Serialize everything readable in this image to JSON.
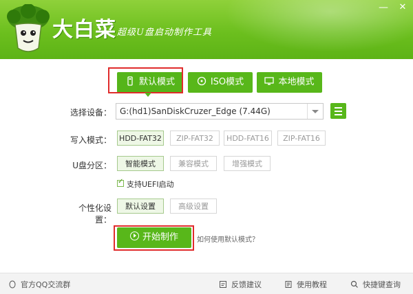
{
  "app": {
    "brand": "大白菜",
    "slogan": "超级U盘启动制作工具"
  },
  "window": {
    "minimize": "—",
    "close": "✕"
  },
  "tabs": [
    {
      "label": "默认模式",
      "icon": "usb-icon",
      "selected": true
    },
    {
      "label": "ISO模式",
      "icon": "disc-icon",
      "selected": false
    },
    {
      "label": "本地模式",
      "icon": "monitor-icon",
      "selected": false
    }
  ],
  "device": {
    "label": "选择设备：",
    "value": "G:(hd1)SanDiskCruzer_Edge (7.44G)",
    "menu_icon": "hamburger-menu-icon"
  },
  "write_mode": {
    "label": "写入模式：",
    "options": [
      "HDD-FAT32",
      "ZIP-FAT32",
      "HDD-FAT16",
      "ZIP-FAT16"
    ],
    "selected": "HDD-FAT32"
  },
  "partition": {
    "label": "U盘分区：",
    "options": [
      "智能模式",
      "兼容模式",
      "增强模式"
    ],
    "selected": "智能模式"
  },
  "uefi": {
    "label": "支持UEFI启动",
    "checked": true
  },
  "personalize": {
    "label": "个性化设置：",
    "options": [
      "默认设置",
      "高级设置"
    ],
    "selected": "默认设置"
  },
  "start": {
    "label": "开始制作",
    "help": "如何使用默认模式？"
  },
  "footer": {
    "qq_group": "官方QQ交流群",
    "feedback": "反馈建议",
    "tutorial": "使用教程",
    "shortcut": "快捷键查询"
  },
  "colors": {
    "accent": "#58b71a",
    "highlight_outline": "#e02b2b"
  }
}
